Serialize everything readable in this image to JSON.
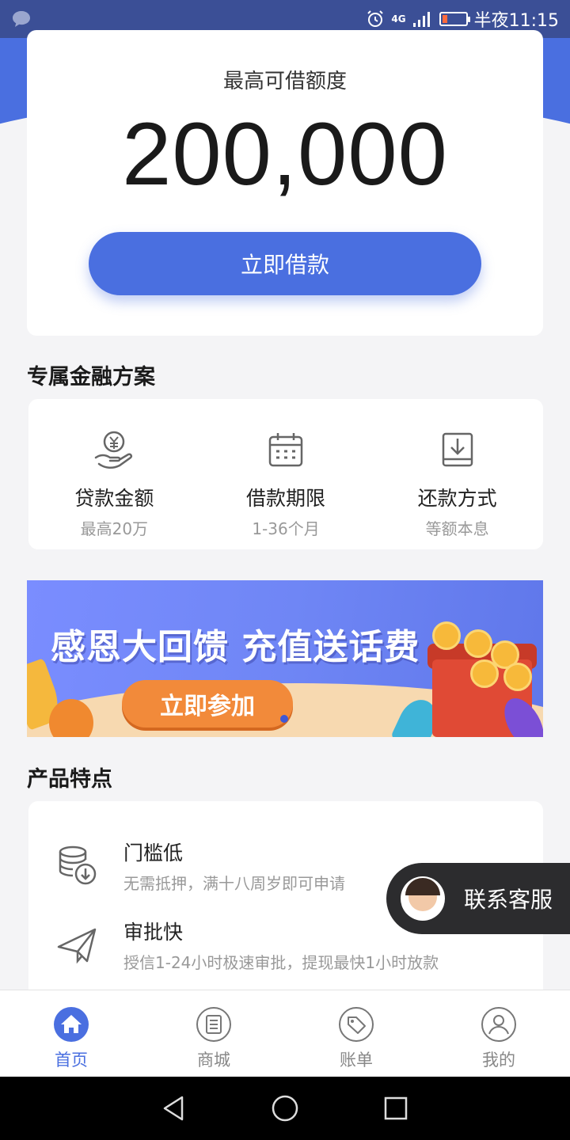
{
  "status_bar": {
    "time": "半夜11:15",
    "network": "4G"
  },
  "limit_card": {
    "title": "最高可借额度",
    "amount": "200,000",
    "borrow_button": "立即借款"
  },
  "plan_section": {
    "title": "专属金融方案",
    "items": [
      {
        "icon": "money-hand-icon",
        "title": "贷款金额",
        "subtitle": "最高20万"
      },
      {
        "icon": "calendar-icon",
        "title": "借款期限",
        "subtitle": "1-36个月"
      },
      {
        "icon": "download-tray-icon",
        "title": "还款方式",
        "subtitle": "等额本息"
      }
    ]
  },
  "banner": {
    "title": "感恩大回馈 充值送话费",
    "button": "立即参加"
  },
  "features_section": {
    "title": "产品特点",
    "items": [
      {
        "icon": "coins-stack-icon",
        "title": "门槛低",
        "subtitle": "无需抵押，满十八周岁即可申请"
      },
      {
        "icon": "paper-plane-icon",
        "title": "审批快",
        "subtitle": "授信1-24小时极速审批，提现最快1小时放款"
      }
    ]
  },
  "customer_service": {
    "label": "联系客服"
  },
  "tabbar": {
    "tabs": [
      {
        "label": "首页",
        "icon": "home-icon",
        "active": true
      },
      {
        "label": "商城",
        "icon": "shop-list-icon",
        "active": false
      },
      {
        "label": "账单",
        "icon": "tag-icon",
        "active": false
      },
      {
        "label": "我的",
        "icon": "user-icon",
        "active": false
      }
    ]
  },
  "colors": {
    "accent": "#4a6fe0",
    "status_bar": "#3b4f96",
    "banner_button": "#f28a3a"
  }
}
